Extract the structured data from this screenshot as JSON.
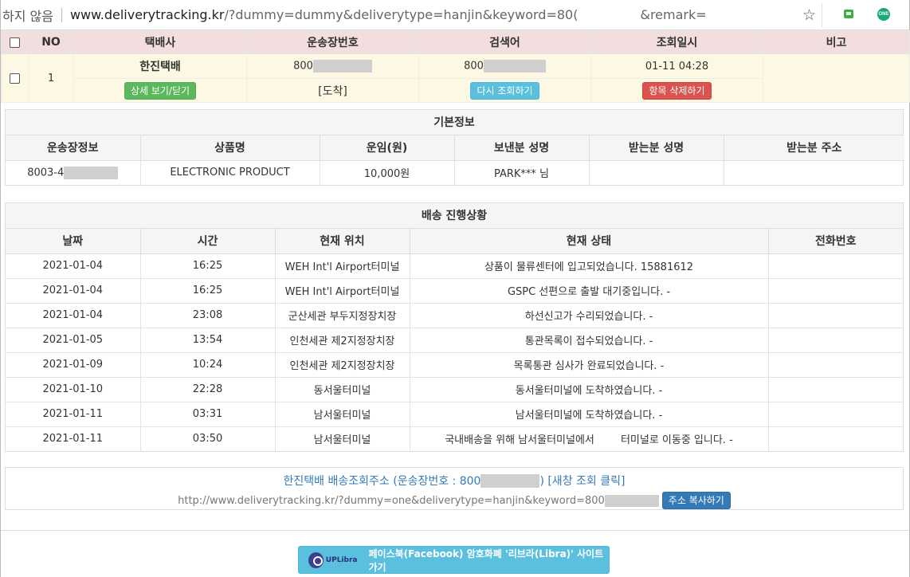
{
  "browser": {
    "security_label": "하지 않음",
    "url_host": "www.deliverytracking.kr",
    "url_path": "/?dummy=dummy&deliverytype=hanjin&keyword=80(",
    "url_tail": "&remark="
  },
  "list": {
    "headers": [
      "NO",
      "택배사",
      "운송장번호",
      "검색어",
      "조회일시",
      "비고"
    ],
    "row": {
      "no": "1",
      "carrier": "한진택배",
      "tracking_prefix": "800",
      "keyword_prefix": "800",
      "datetime": "01-11 04:28",
      "remark": "",
      "status": "[도착]"
    },
    "buttons": {
      "detail": "상세 보기/닫기",
      "requery": "다시 조회하기",
      "delete": "항목 삭제하기"
    }
  },
  "basic_info": {
    "title": "기본정보",
    "headers": [
      "운송장정보",
      "상품명",
      "운임(원)",
      "보낸분 성명",
      "받는분 성명",
      "받는분 주소"
    ],
    "row": {
      "waybill_prefix": "8003-4",
      "product": "ELECTRONIC PRODUCT",
      "fee": "10,000원",
      "sender": "PARK*** 님",
      "receiver": "",
      "address": ""
    }
  },
  "progress": {
    "title": "배송 진행상황",
    "headers": [
      "날짜",
      "시간",
      "현재 위치",
      "현재 상태",
      "전화번호"
    ],
    "rows": [
      {
        "date": "2021-01-04",
        "time": "16:25",
        "location": "WEH Int'l Airport터미널",
        "status": "상품이 물류센터에 입고되었습니다. 15881612",
        "phone": ""
      },
      {
        "date": "2021-01-04",
        "time": "16:25",
        "location": "WEH Int'l Airport터미널",
        "status": "GSPC 선편으로 출발 대기중입니다. -",
        "phone": ""
      },
      {
        "date": "2021-01-04",
        "time": "23:08",
        "location": "군산세관 부두지정장치장",
        "status": "하선신고가 수리되었습니다. -",
        "phone": ""
      },
      {
        "date": "2021-01-05",
        "time": "13:54",
        "location": "인천세관 제2지정장치장",
        "status": "통관목록이 접수되었습니다. -",
        "phone": ""
      },
      {
        "date": "2021-01-09",
        "time": "10:24",
        "location": "인천세관 제2지정장치장",
        "status": "목록통관 심사가 완료되었습니다. -",
        "phone": ""
      },
      {
        "date": "2021-01-10",
        "time": "22:28",
        "location": "동서울터미널",
        "status": "동서울터미널에 도착하였습니다. -",
        "phone": ""
      },
      {
        "date": "2021-01-11",
        "time": "03:31",
        "location": "남서울터미널",
        "status": "남서울터미널에 도착하였습니다. -",
        "phone": ""
      },
      {
        "date": "2021-01-11",
        "time": "03:50",
        "location": "남서울터미널",
        "status": "국내배송을 위해 남서울터미널에서        터미널로 이동중 입니다. -",
        "phone": ""
      }
    ]
  },
  "linkbox": {
    "title_prefix": "한진택배 배송조회주소 (운송장번호 : 800",
    "title_suffix": ") [새창 조회 클릭]",
    "url": "http://www.deliverytracking.kr/?dummy=one&deliverytype=hanjin&keyword=800",
    "copy_button": "주소 복사하기"
  },
  "libra": {
    "brand": "UPLibra",
    "label": "페이스북(Facebook) 암호화폐 '리브라(Libra)' 사이트 가기"
  },
  "extensions": {
    "one_label": "ONE"
  },
  "colors": {
    "list_header_bg": "#f2dede",
    "list_row_bg": "#fcf8e3",
    "green_button": "#5cb85c",
    "info_button": "#5bc0de",
    "danger_button": "#d9534f",
    "primary_button": "#337ab7",
    "link_text": "#337ab7"
  }
}
